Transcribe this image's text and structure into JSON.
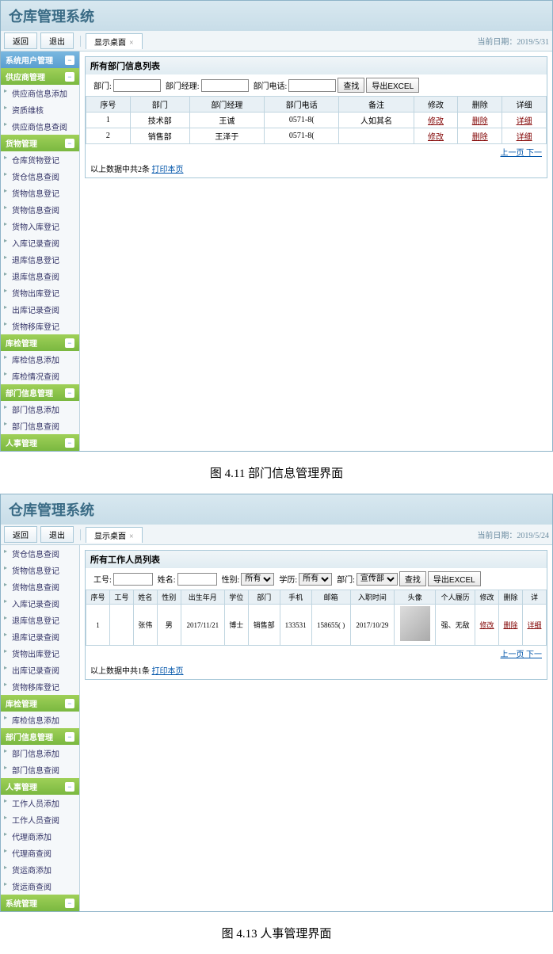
{
  "app_title": "仓库管理系统",
  "toolbar": {
    "back": "返回",
    "exit": "退出",
    "tab": "显示桌面",
    "date1": "当前日期：2019/5/31 ",
    "date2": "当前日期：2019/5/24"
  },
  "caption1": "图 4.11  部门信息管理界面",
  "caption2": "图 4.13  人事管理界面",
  "sidebar1": {
    "groups": [
      {
        "title": "系统用户管理",
        "style": "blue",
        "items": []
      },
      {
        "title": "供应商管理",
        "style": "green",
        "items": [
          "供应商信息添加",
          "资质维核",
          "供应商信息查阅"
        ]
      },
      {
        "title": "货物管理",
        "style": "green",
        "items": [
          "仓库货物登记",
          "货仓信息查阅",
          "货物信息登记",
          "货物信息查阅",
          "货物入库登记",
          "入库记录查阅",
          "退库信息登记",
          "退库信息查阅",
          "货物出库登记",
          "出库记录查阅",
          "货物移库登记"
        ]
      },
      {
        "title": "库检管理",
        "style": "green",
        "items": [
          "库检信息添加",
          "库检情况查阅"
        ]
      },
      {
        "title": "部门信息管理",
        "style": "green",
        "items": [
          "部门信息添加",
          "部门信息查阅"
        ]
      },
      {
        "title": "人事管理",
        "style": "green",
        "items": []
      }
    ]
  },
  "sidebar2": {
    "groups": [
      {
        "title": "",
        "style": "",
        "items": [
          "货仓信息查阅",
          "货物信息登记",
          "货物信息查阅",
          "入库记录查阅",
          "退库信息登记",
          "退库记录查阅",
          "货物出库登记",
          "出库记录查阅",
          "货物移库登记"
        ]
      },
      {
        "title": "库检管理",
        "style": "green",
        "items": [
          "库检信息添加"
        ]
      },
      {
        "title": "部门信息管理",
        "style": "green",
        "items": [
          "部门信息添加",
          "部门信息查阅"
        ]
      },
      {
        "title": "人事管理",
        "style": "green",
        "items": [
          "工作人员添加",
          "工作人员查阅",
          "代理商添加",
          "代理商查阅",
          "货运商添加",
          "货运商查阅"
        ]
      },
      {
        "title": "系统管理",
        "style": "green",
        "items": []
      }
    ]
  },
  "panel1": {
    "title": "所有部门信息列表",
    "search": {
      "dept": "部门:",
      "mgr": "部门经理:",
      "tel": "部门电话:",
      "find": "查找",
      "export": "导出EXCEL"
    },
    "headers": [
      "序号",
      "部门",
      "部门经理",
      "部门电话",
      "备注",
      "修改",
      "删除",
      "详细"
    ],
    "rows": [
      {
        "no": "1",
        "dept": "技术部",
        "mgr": "王诚",
        "tel": "0571-8(",
        "remark": "人如其名",
        "edit": "修改",
        "del": "删除",
        "det": "详细"
      },
      {
        "no": "2",
        "dept": "销售部",
        "mgr": "王泽于",
        "tel": "0571-8(",
        "remark": "",
        "edit": "修改",
        "del": "删除",
        "det": "详细"
      }
    ],
    "pager": "上一页 下一",
    "footer_prefix": "以上数据中共2条 ",
    "footer_link": "打印本页"
  },
  "panel2": {
    "title": "所有工作人员列表",
    "search": {
      "id": "工号:",
      "name": "姓名:",
      "sex": "性别:",
      "sex_opt": "所有",
      "edu": "学历:",
      "edu_opt": "所有",
      "dept": "部门:",
      "dept_opt": "宣传部",
      "find": "查找",
      "export": "导出EXCEL"
    },
    "headers": [
      "序号",
      "工号",
      "姓名",
      "性别",
      "出生年月",
      "学位",
      "部门",
      "手机",
      "邮箱",
      "入职时间",
      "头像",
      "个人履历",
      "修改",
      "删除",
      "详"
    ],
    "rows": [
      {
        "no": "1",
        "id": "",
        "name": "张伟",
        "sex": "男",
        "birth": "2017/11/21",
        "edu": "博士",
        "dept": "销售部",
        "phone": "133531",
        "mail": "158655(   )",
        "hire": "2017/10/29",
        "cv": "强、无敌",
        "edit": "修改",
        "del": "删除",
        "det": "详细"
      }
    ],
    "pager": "上一页 下一",
    "footer_prefix": "以上数据中共1条 ",
    "footer_link": "打印本页"
  }
}
